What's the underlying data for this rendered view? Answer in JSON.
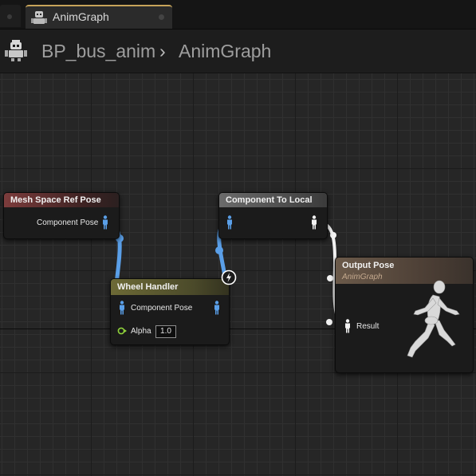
{
  "tabs": [
    {
      "label": "AnimGraph",
      "active": true
    }
  ],
  "breadcrumb": {
    "blueprint": "BP_bus_anim",
    "separator": "›",
    "graph": "AnimGraph"
  },
  "nodes": {
    "mesh_space_ref_pose": {
      "title": "Mesh Space Ref Pose",
      "output_pin": "Component Pose"
    },
    "component_to_local": {
      "title": "Component To Local"
    },
    "wheel_handler": {
      "title": "Wheel Handler",
      "pose_pin": "Component Pose",
      "alpha_label": "Alpha",
      "alpha_value": "1.0"
    },
    "output_pose": {
      "title": "Output Pose",
      "subtitle": "AnimGraph",
      "input_pin": "Result"
    }
  },
  "colors": {
    "component_space_wire": "#5a9fe8",
    "local_space_wire": "#f2f2f2",
    "alpha_pin": "#8fd23a"
  },
  "icons": {
    "tab": "character-blueprint-icon",
    "breadcrumb": "character-blueprint-icon",
    "pose_pin": "pose-figure-icon",
    "output_preview": "running-mannequin-icon",
    "wheel_handler_badge": "lightning-icon"
  }
}
